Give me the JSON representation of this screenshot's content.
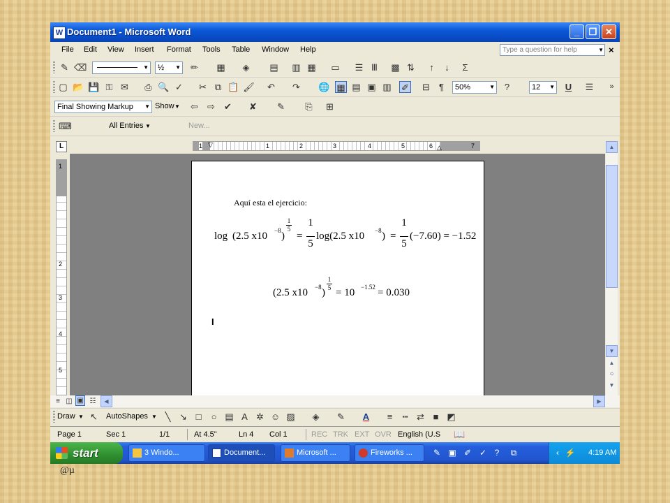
{
  "window": {
    "title": "Document1 - Microsoft Word",
    "buttons": [
      "_",
      "❐",
      "✕"
    ]
  },
  "menu": {
    "items": [
      "File",
      "Edit",
      "View",
      "Insert",
      "Format",
      "Tools",
      "Table",
      "Window",
      "Help"
    ],
    "help_placeholder": "Type a question for help",
    "help_close": "×"
  },
  "toolbar_drawing": {
    "line_weight": "½"
  },
  "toolbar_standard": {
    "zoom": "50%",
    "font_size": "12",
    "underline": "U"
  },
  "toolbar_reviewing": {
    "display_for_review": "Final Showing Markup",
    "show_label": "Show"
  },
  "toolbar_autotext": {
    "all_entries": "All Entries",
    "new_label": "New..."
  },
  "ruler": {
    "numbers": [
      "1",
      "1",
      "2",
      "3",
      "4",
      "5",
      "6",
      "7"
    ]
  },
  "document": {
    "intro": "Aquí esta el ejercicio:",
    "eq1": {
      "log": "log",
      "base": "(2.5 x10",
      "exp_neg8": "−8",
      "close": ")",
      "frac_num": "1",
      "frac_den": "5",
      "equals": "=",
      "log2": "log(2.5 x10",
      "result_paren": "(−7.60) = −1.52"
    },
    "eq2": {
      "base": "(2.5 x10",
      "exp_neg8": "−8",
      "close": ")",
      "frac_num": "1",
      "frac_den": "5",
      "rhs": "= 10",
      "rhs_exp": "−1.52",
      "result": "= 0.030"
    },
    "cursor": "I"
  },
  "draw_toolbar": {
    "draw_label": "Draw",
    "autoshapes_label": "AutoShapes"
  },
  "status": {
    "page": "Page 1",
    "sec": "Sec 1",
    "pages": "1/1",
    "at": "At 4.5\"",
    "ln": "Ln 4",
    "col": "Col 1",
    "rec": "REC",
    "trk": "TRK",
    "ext": "EXT",
    "ovr": "OVR",
    "lang": "English (U.S"
  },
  "taskbar": {
    "start_label": "start",
    "tasks": [
      "3 Windo...",
      "Document...",
      "Microsoft ...",
      "Fireworks ..."
    ],
    "clock": "4:19 AM"
  },
  "caption": "@µ",
  "colors": {
    "xp_blue": "#0a58d8",
    "start_green": "#2f8f2f",
    "background": "#e6cc92"
  }
}
